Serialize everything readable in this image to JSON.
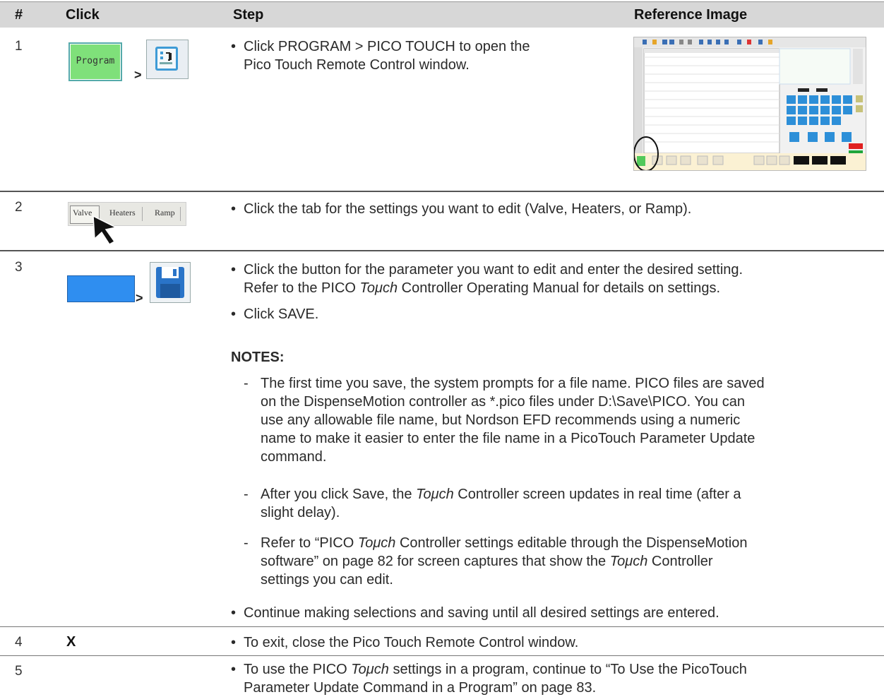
{
  "header": {
    "num": "#",
    "click": "Click",
    "step": "Step",
    "ref": "Reference Image"
  },
  "rows": [
    {
      "num": "1",
      "click": {
        "program_label": "Program",
        "separator": ">"
      },
      "bullets": [
        {
          "line1": "Click PROGRAM > PICO TOUCH to open the",
          "line2": "Pico Touch Remote Control window."
        }
      ]
    },
    {
      "num": "2",
      "click": {
        "tabs": [
          "Valve",
          "Heaters",
          "Ramp"
        ]
      },
      "bullets": [
        {
          "text": "Click the tab for the settings you want to edit (Valve, Heaters, or Ramp)."
        }
      ]
    },
    {
      "num": "3",
      "click": {
        "separator": ">"
      },
      "bullets": [
        {
          "line1": "Click the button for the parameter you want to edit and enter the desired setting.",
          "line2_pre": "Refer to the PICO ",
          "line2_em": "Toμch",
          "line2_post": " Controller Operating Manual for details on settings."
        },
        {
          "text": "Click SAVE."
        }
      ],
      "notes_heading": "NOTES:",
      "notes": [
        {
          "lines": [
            "The first time you save, the system prompts for a file name. PICO files are saved",
            "on the DispenseMotion controller as *.pico files under D:\\Save\\PICO. You can",
            "use any allowable file name, but Nordson EFD recommends using a numeric",
            "name to make it easier to enter the file name in a PicoTouch Parameter Update",
            "command."
          ]
        },
        {
          "l1_pre": "After you click Save, the ",
          "l1_em": "Toμch",
          "l1_post": " Controller screen updates in real time (after a",
          "l2": "slight delay)."
        },
        {
          "l1_pre": "Refer to “PICO ",
          "l1_em": "Toμch",
          "l1_post": " Controller settings editable through the DispenseMotion",
          "l2_pre": "software” on page 82 for screen captures that show the ",
          "l2_em": "Toμch",
          "l2_post": " Controller",
          "l3": "settings you can edit."
        }
      ],
      "final_bullet": "Continue making selections and saving until all desired settings are entered."
    },
    {
      "num": "4",
      "click": {
        "label": "X"
      },
      "bullets": [
        {
          "text": "To exit, close the Pico Touch Remote Control window."
        }
      ]
    },
    {
      "num": "5",
      "bullets": [
        {
          "l1_pre": "To use the PICO ",
          "l1_em": "Toμch",
          "l1_post": " settings in a program, continue to “To Use the PicoTouch",
          "l2": "Parameter Update Command in a Program” on page 83."
        }
      ]
    }
  ],
  "bullet_glyph": "•",
  "dash_glyph": "-"
}
